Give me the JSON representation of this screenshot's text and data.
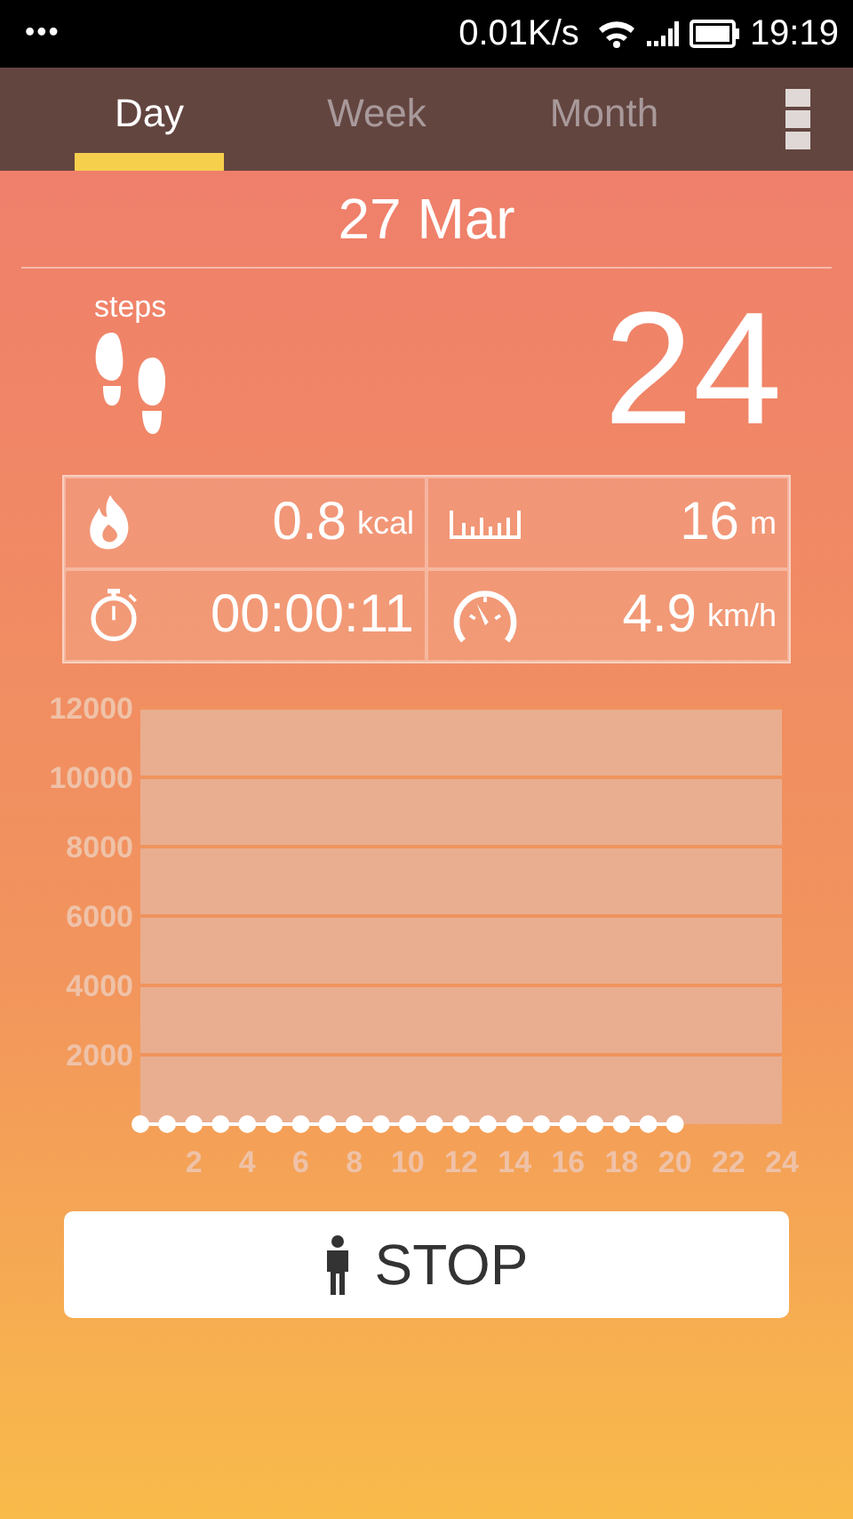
{
  "status_bar": {
    "dots": "•••",
    "speed": "0.01K/s",
    "time": "19:19"
  },
  "tabs": [
    {
      "label": "Day",
      "selected": true
    },
    {
      "label": "Week",
      "selected": false
    },
    {
      "label": "Month",
      "selected": false
    }
  ],
  "date": "27 Mar",
  "steps": {
    "label": "steps",
    "value": "24"
  },
  "stats": [
    {
      "kind": "calories",
      "value": "0.8",
      "unit": "kcal"
    },
    {
      "kind": "distance",
      "value": "16",
      "unit": "m"
    },
    {
      "kind": "duration",
      "value": "00:00:11"
    },
    {
      "kind": "speed",
      "value": "4.9",
      "unit": "km/h"
    }
  ],
  "chart_data": {
    "type": "line",
    "x": [
      0,
      1,
      2,
      3,
      4,
      5,
      6,
      7,
      8,
      9,
      10,
      11,
      12,
      13,
      14,
      15,
      16,
      17,
      18,
      19,
      20
    ],
    "grid": true,
    "series": [
      {
        "color": "#ffffff",
        "marker": true,
        "values": [
          0,
          0,
          0,
          0,
          0,
          0,
          0,
          0,
          0,
          0,
          0,
          0,
          0,
          0,
          0,
          0,
          0,
          0,
          0,
          0,
          0
        ]
      }
    ],
    "xlim": [
      0,
      24
    ],
    "ylim": [
      0,
      12000
    ],
    "xticks": [
      2,
      4,
      6,
      8,
      10,
      12,
      14,
      16,
      18,
      20,
      22,
      24
    ],
    "yticks": [
      2000,
      4000,
      6000,
      8000,
      10000,
      12000
    ]
  },
  "stop_button": {
    "label": "STOP"
  }
}
